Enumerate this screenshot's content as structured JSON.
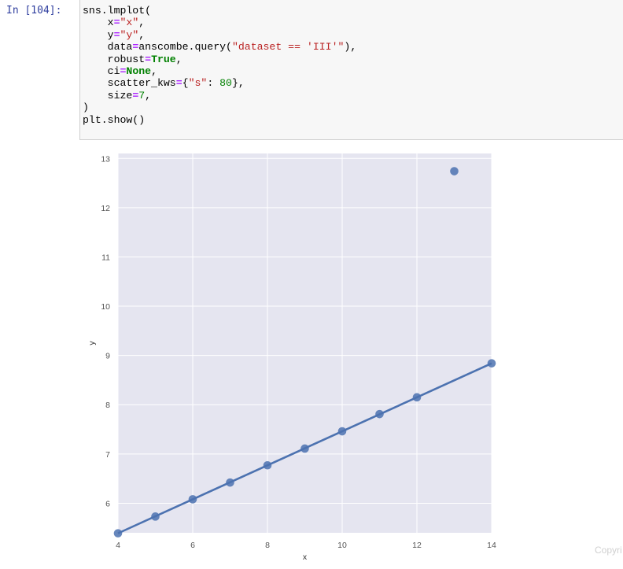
{
  "cell": {
    "prompt": "In [104]:",
    "code": {
      "l1": "sns.lmplot(",
      "l2_name": "x",
      "l2_val": "\"x\"",
      "l3_name": "y",
      "l3_val": "\"y\"",
      "l4_name": "data",
      "l4_pre": "anscombe.query(",
      "l4_str": "\"dataset == 'III'\"",
      "l4_post": "),",
      "l5_name": "robust",
      "l5_val": "True",
      "l6_name": "ci",
      "l6_val": "None",
      "l7_name": "scatter_kws",
      "l7_pre": "{",
      "l7_str": "\"s\"",
      "l7_mid": ": ",
      "l7_num": "80",
      "l7_post": "},",
      "l8_name": "size",
      "l8_val": "7",
      "op": "=",
      "comma": ",",
      "close": ")",
      "show": "plt.show()"
    }
  },
  "chart_data": {
    "type": "scatter",
    "xlabel": "x",
    "ylabel": "y",
    "xlim": [
      4,
      14
    ],
    "ylim": [
      5.4,
      13.1
    ],
    "xticks": [
      4,
      6,
      8,
      10,
      12,
      14
    ],
    "yticks": [
      6,
      7,
      8,
      9,
      10,
      11,
      12,
      13
    ],
    "grid": true,
    "points": [
      {
        "x": 10,
        "y": 7.46
      },
      {
        "x": 8,
        "y": 6.77
      },
      {
        "x": 13,
        "y": 12.74
      },
      {
        "x": 9,
        "y": 7.11
      },
      {
        "x": 11,
        "y": 7.81
      },
      {
        "x": 14,
        "y": 8.84
      },
      {
        "x": 6,
        "y": 6.08
      },
      {
        "x": 4,
        "y": 5.39
      },
      {
        "x": 12,
        "y": 8.15
      },
      {
        "x": 7,
        "y": 6.42
      },
      {
        "x": 5,
        "y": 5.73
      }
    ],
    "fit_line": {
      "x0": 4,
      "y0": 5.39,
      "x1": 14,
      "y1": 8.84
    },
    "colors": {
      "background": "#e5e5f0",
      "grid": "#ffffff",
      "points": "#4c72b0"
    }
  },
  "watermark": "Copyri"
}
